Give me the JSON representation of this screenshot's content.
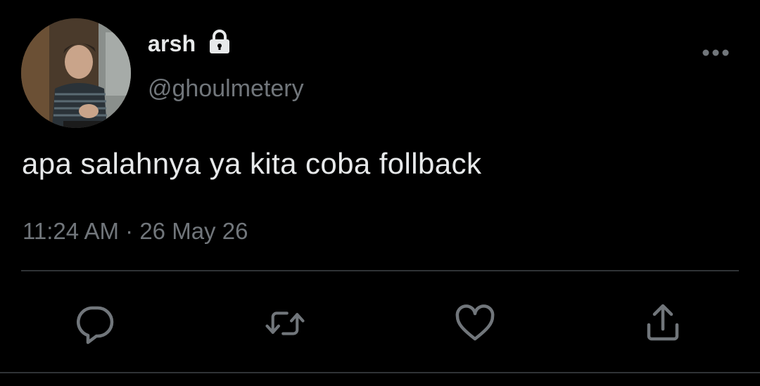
{
  "tweet": {
    "display_name": "arsh",
    "handle": "@ghoulmetery",
    "text": "apa salahnya ya kita coba follback",
    "time": "11:24 AM",
    "separator": "·",
    "date": "26 May 26"
  },
  "icons": {
    "lock": "lock-icon",
    "more": "more-horizontal-icon",
    "reply": "reply-icon",
    "retweet": "retweet-icon",
    "like": "heart-icon",
    "share": "share-icon"
  },
  "colors": {
    "background": "#000000",
    "primary_text": "#e7e9ea",
    "secondary_text": "#71767b",
    "divider": "#2f3336"
  }
}
